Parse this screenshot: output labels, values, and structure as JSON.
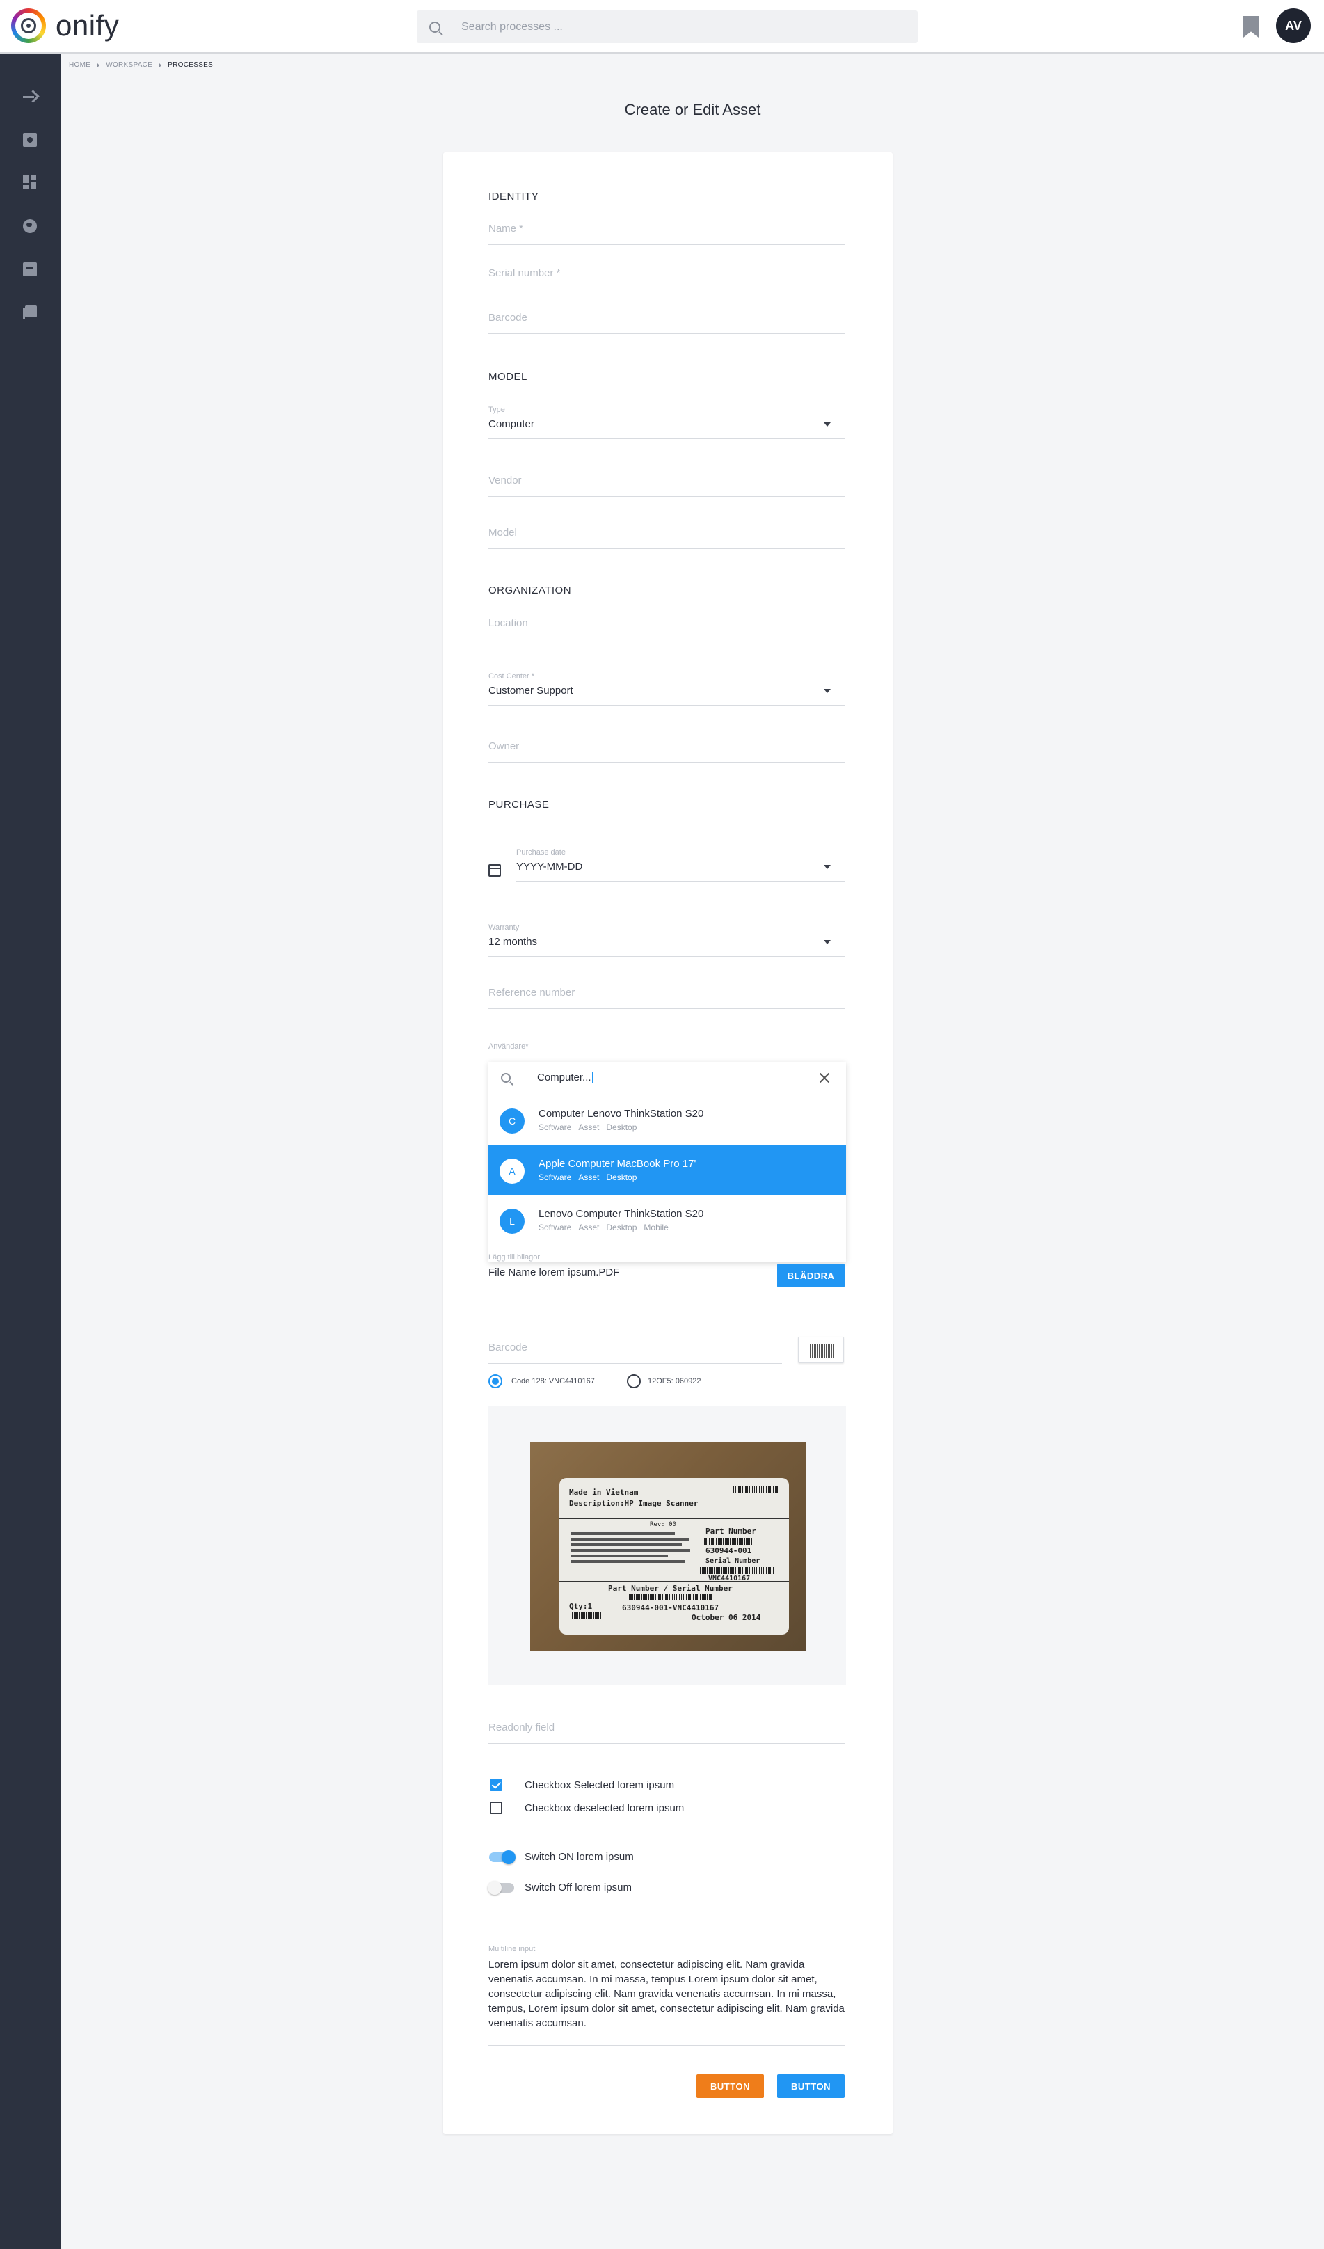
{
  "header": {
    "brand": "onify",
    "search_placeholder": "Search processes ...",
    "avatar_initials": "AV"
  },
  "sidebar": {
    "icons": [
      "arrow-right-icon",
      "document-icon",
      "dashboard-icon",
      "globe-icon",
      "folder-icon",
      "library-icon"
    ]
  },
  "breadcrumb": [
    "HOME",
    "WORKSPACE",
    "PROCESSES"
  ],
  "page_title": "Create or Edit Asset",
  "form": {
    "identity": {
      "heading": "IDENTITY",
      "name_placeholder": "Name *",
      "serial_placeholder": "Serial number *",
      "barcode_placeholder": "Barcode"
    },
    "model": {
      "heading": "MODEL",
      "type_label": "Type",
      "type_value": "Computer",
      "vendor_placeholder": "Vendor",
      "model_placeholder": "Model"
    },
    "organization": {
      "heading": "ORGANIZATION",
      "location_placeholder": "Location",
      "cost_center_label": "Cost Center *",
      "cost_center_value": "Customer Support",
      "owner_placeholder": "Owner"
    },
    "purchase": {
      "heading": "PURCHASE",
      "date_label": "Purchase date",
      "date_value": "YYYY-MM-DD",
      "warranty_label": "Warranty",
      "warranty_value": "12 months",
      "reference_placeholder": "Reference number",
      "user_label": "Användare*"
    },
    "autocomplete": {
      "query": "Computer...",
      "items": [
        {
          "badge": "C",
          "title": "Computer Lenovo ThinkStation S20",
          "tags": [
            "Software",
            "Asset",
            "Desktop"
          ]
        },
        {
          "badge": "A",
          "title": "Apple  Computer MacBook Pro 17'",
          "tags": [
            "Software",
            "Asset",
            "Desktop"
          ]
        },
        {
          "badge": "L",
          "title": "Lenovo  Computer ThinkStation S20",
          "tags": [
            "Software",
            "Asset",
            "Desktop",
            "Mobile"
          ]
        }
      ],
      "selected_index": 1
    },
    "upload": {
      "label": "Lägg till bilagor",
      "file_name": "File Name lorem ipsum.PDF",
      "browse_label": "BLÄDDRA"
    },
    "barcode2": {
      "placeholder": "Barcode",
      "options": [
        "Code 128: VNC4410167",
        "12OF5: 060922"
      ],
      "selected": 0
    },
    "photo_label": {
      "line1": "Made in Vietnam",
      "line2": "Description:HP Image Scanner",
      "rev": "Rev: 00",
      "part_number_title": "Part Number",
      "part_number": "630944-001",
      "serial_title": "Serial Number",
      "serial": "VNC4410167",
      "pn_sn_title": "Part Number / Serial Number",
      "pn_sn": "630944-001-VNC4410167",
      "qty": "Qty:1",
      "date": "October 06 2014"
    },
    "readonly_placeholder": "Readonly field",
    "checkboxes": [
      {
        "label": "Checkbox Selected lorem ipsum",
        "checked": true
      },
      {
        "label": "Checkbox deselected lorem ipsum",
        "checked": false
      }
    ],
    "switches": [
      {
        "label": "Switch ON lorem ipsum",
        "on": true
      },
      {
        "label": "Switch Off lorem ipsum",
        "on": false
      }
    ],
    "multiline": {
      "label": "Multiline input",
      "value": "Lorem ipsum dolor sit amet, consectetur adipiscing elit. Nam gravida venenatis accumsan. In mi massa, tempus Lorem ipsum dolor sit amet, consectetur adipiscing elit. Nam gravida venenatis accumsan. In mi massa, tempus, Lorem ipsum dolor sit amet, consectetur adipiscing elit. Nam gravida venenatis accumsan."
    },
    "buttons": {
      "primary_label": "BUTTON",
      "secondary_label": "BUTTON"
    }
  },
  "colors": {
    "accent": "#2196f3",
    "orange": "#ef7d1a",
    "sidebar": "#2c3240"
  }
}
